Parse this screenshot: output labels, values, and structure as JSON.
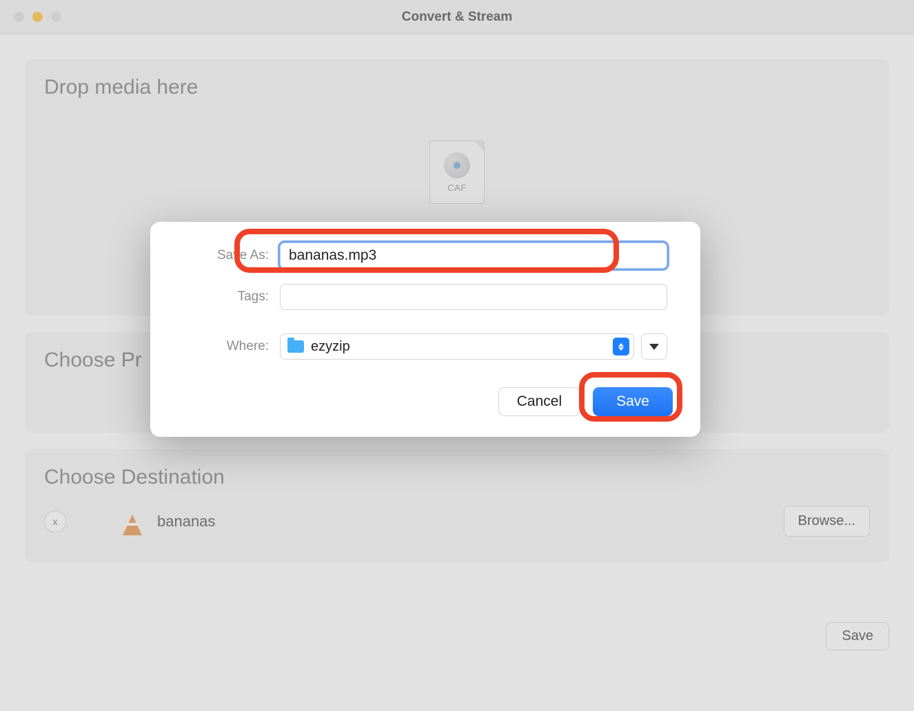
{
  "window": {
    "title": "Convert & Stream"
  },
  "panels": {
    "drop": {
      "heading": "Drop media here",
      "file_type_label": "CAF"
    },
    "profile": {
      "heading": "Choose Pr"
    },
    "destination": {
      "heading": "Choose Destination",
      "remove_label": "x",
      "filename": "bananas",
      "browse_label": "Browse..."
    }
  },
  "footer": {
    "save_label": "Save"
  },
  "sheet": {
    "save_as_label": "Save As:",
    "save_as_value": "bananas.mp3",
    "tags_label": "Tags:",
    "tags_value": "",
    "where_label": "Where:",
    "where_folder": "ezyzip",
    "cancel_label": "Cancel",
    "save_label": "Save"
  }
}
